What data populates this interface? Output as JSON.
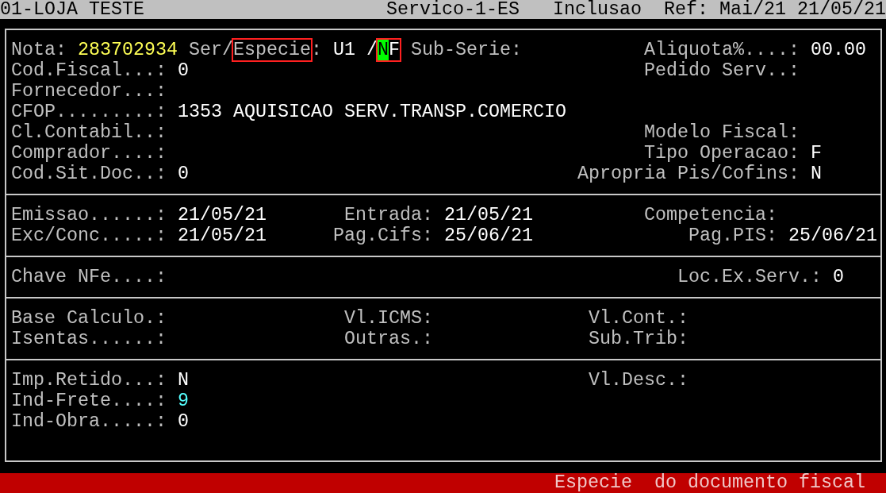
{
  "header": {
    "title": "01-LOJA TESTE",
    "module": "Servico-1-ES",
    "mode": "Inclusao",
    "reference": "Ref: Mai/21 21/05/21"
  },
  "sections": [
    {
      "rows": [
        {
          "left": {
            "parts": [
              {
                "kind": "label",
                "text": "Nota:",
                "highlighted": false
              },
              {
                "kind": "value",
                "text": "283702934",
                "color": "#ffff55",
                "highlighted": false
              },
              {
                "kind": "label",
                "text": "Ser/",
                "highlighted": false
              },
              {
                "kind": "label",
                "text": "Especie",
                "highlighted": true
              },
              {
                "kind": "label",
                "text": ":",
                "highlighted": false
              },
              {
                "kind": "value",
                "text": "U1 /",
                "highlighted": false
              },
              {
                "kind": "value",
                "text": "NF",
                "highlighted": true,
                "cursor": true
              },
              {
                "kind": "label",
                "text": "Sub-Serie:",
                "highlighted": false
              }
            ]
          },
          "right": {
            "label": "Aliquota%....:",
            "value": "00.00"
          }
        },
        {
          "left": {
            "label": "Cod.Fiscal...:",
            "value": "0"
          },
          "right": {
            "label": "Pedido Serv..:"
          }
        },
        {
          "left": {
            "label": "Fornecedor...:"
          }
        },
        {
          "left": {
            "label": "CFOP.........:",
            "value": "1353 AQUISICAO SERV.TRANSP.COMERCIO"
          }
        },
        {
          "left": {
            "label": "Cl.Contabil..:"
          },
          "right": {
            "label": "Modelo Fiscal:"
          }
        },
        {
          "left": {
            "label": "Comprador....:"
          },
          "right": {
            "label": "Tipo Operacao:",
            "value": "F"
          }
        },
        {
          "left": {
            "label": "Cod.Sit.Doc..:",
            "value": "0"
          },
          "right": {
            "label": "Apropria Pis/Cofins:",
            "value": "N"
          }
        }
      ]
    },
    {
      "rows": [
        {
          "left": {
            "label": "Emissao......:",
            "value": "21/05/21"
          },
          "middle": {
            "label": "Entrada:",
            "value": "21/05/21"
          },
          "right": {
            "label": "Competencia:"
          }
        },
        {
          "left": {
            "label": "Exc/Conc.....:",
            "value": "21/05/21"
          },
          "middle": {
            "label": "Pag.Cifs:",
            "value": "25/06/21"
          },
          "right": {
            "label": "Pag.PIS:",
            "value": "25/06/21"
          }
        }
      ]
    },
    {
      "rows": [
        {
          "left": {
            "label": "Chave NFe....:"
          },
          "right": {
            "label": "Loc.Ex.Serv.:",
            "value": "0"
          }
        }
      ]
    },
    {
      "rows": [
        {
          "left": {
            "label": "Base Calculo.:"
          },
          "middle": {
            "label": "Vl.ICMS:"
          },
          "right": {
            "label": "Vl.Cont.:"
          }
        },
        {
          "left": {
            "label": "Isentas......:"
          },
          "middle": {
            "label": "Outras.:"
          },
          "right": {
            "label": "Sub.Trib:"
          }
        }
      ]
    },
    {
      "rows": [
        {
          "left": {
            "label": "Imp.Retido...:",
            "value": "N"
          },
          "right": {
            "label": "Vl.Desc.:"
          }
        },
        {
          "left": {
            "label": "Ind-Frete....:",
            "value": "9",
            "color": "#55ffff"
          }
        },
        {
          "left": {
            "label": "Ind-Obra.....:",
            "value": "0"
          }
        }
      ]
    }
  ],
  "status_bar": {
    "message": "Especie  do documento fiscal"
  }
}
